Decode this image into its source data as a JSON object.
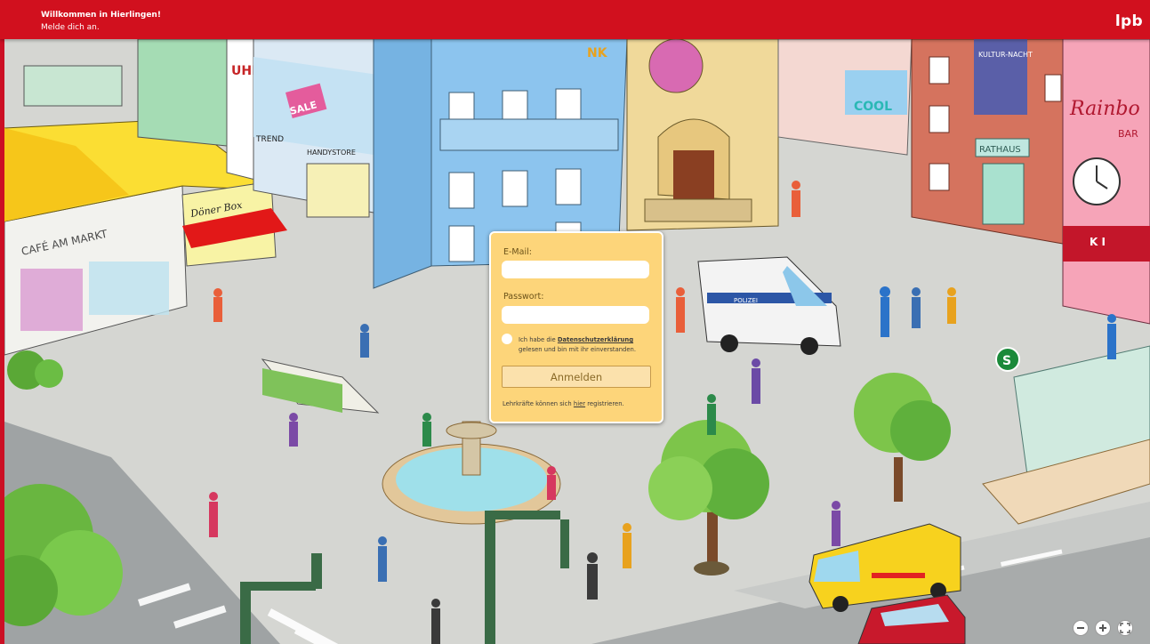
{
  "header": {
    "title": "Willkommen in Hierlingen!",
    "subtitle": "Melde dich an.",
    "logo_text": "lpb"
  },
  "login": {
    "email_label": "E-Mail:",
    "email_value": "",
    "password_label": "Passwort:",
    "password_value": "",
    "consent_prefix": "Ich habe die",
    "consent_link": "Datenschutzerklärung",
    "consent_suffix": "gelesen und bin mit ihr einverstanden.",
    "submit_label": "Anmelden",
    "register_prefix": "Lehrkräfte können sich",
    "register_link": "hier",
    "register_suffix": "registrieren."
  },
  "map": {
    "signs": {
      "cafe": "CAFÉ AM MARKT",
      "doener": "Döner Box",
      "handystore": "HANDYSTORE",
      "trend": "TREND",
      "sale": "SALE",
      "rathaus": "RATHAUS",
      "kultur": "KULTUR-NACHT",
      "rainbow": "Rainbo",
      "bar": "BAR",
      "cool": "COOL",
      "polizei": "POLIZEI",
      "s_bahn": "S",
      "shop_letters_top": "UHE",
      "shop_letters_nk": "NK",
      "right_edge_k": "K I"
    }
  },
  "zoom_controls": {
    "zoom_out_icon": "minus-icon",
    "zoom_in_icon": "plus-icon",
    "fullscreen_icon": "fullscreen-icon"
  },
  "colors": {
    "brand_red": "#d1101e",
    "login_card": "#fdd57a",
    "button_fill": "#fbe1ac",
    "button_border": "#c69a4a"
  }
}
